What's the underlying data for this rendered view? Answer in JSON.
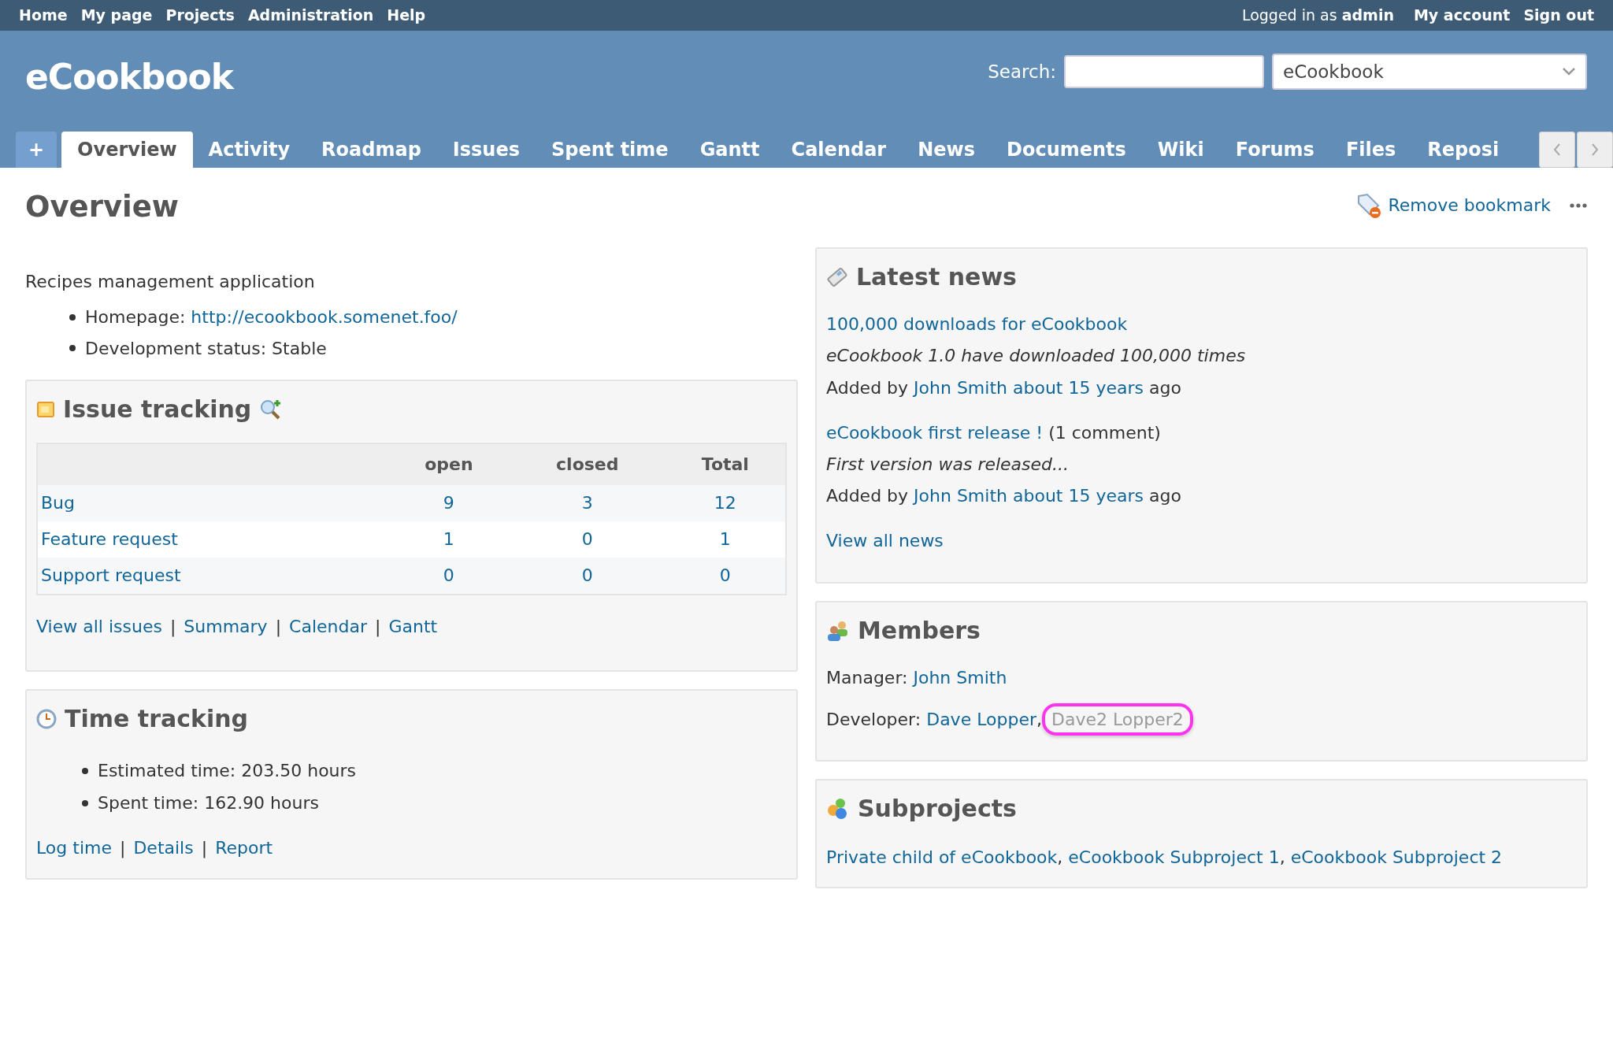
{
  "top_menu": [
    {
      "label": "Home"
    },
    {
      "label": "My page"
    },
    {
      "label": "Projects"
    },
    {
      "label": "Administration"
    },
    {
      "label": "Help"
    }
  ],
  "account": {
    "prefix": "Logged in as",
    "user": "admin",
    "links": [
      "My account",
      "Sign out"
    ]
  },
  "header": {
    "title": "eCookbook",
    "search_label": "Search:",
    "project_select": "eCookbook"
  },
  "tabs": [
    {
      "label": "+",
      "kind": "new",
      "selected": false
    },
    {
      "label": "Overview",
      "kind": "tab",
      "selected": true
    },
    {
      "label": "Activity",
      "kind": "tab",
      "selected": false
    },
    {
      "label": "Roadmap",
      "kind": "tab",
      "selected": false
    },
    {
      "label": "Issues",
      "kind": "tab",
      "selected": false
    },
    {
      "label": "Spent time",
      "kind": "tab",
      "selected": false
    },
    {
      "label": "Gantt",
      "kind": "tab",
      "selected": false
    },
    {
      "label": "Calendar",
      "kind": "tab",
      "selected": false
    },
    {
      "label": "News",
      "kind": "tab",
      "selected": false
    },
    {
      "label": "Documents",
      "kind": "tab",
      "selected": false
    },
    {
      "label": "Wiki",
      "kind": "tab",
      "selected": false
    },
    {
      "label": "Forums",
      "kind": "tab",
      "selected": false
    },
    {
      "label": "Files",
      "kind": "tab",
      "selected": false
    },
    {
      "label": "Reposi",
      "kind": "tab",
      "selected": false
    }
  ],
  "page": {
    "title": "Overview",
    "bookmark": "Remove bookmark"
  },
  "description": "Recipes management application",
  "attributes": [
    {
      "label": "Homepage:",
      "value": "http://ecookbook.somenet.foo/",
      "kind": "link"
    },
    {
      "label": "Development status:",
      "value": "Stable",
      "kind": "text"
    }
  ],
  "issue_tracking": {
    "title": "Issue tracking",
    "columns": [
      "open",
      "closed",
      "Total"
    ],
    "rows": [
      {
        "tracker": "Bug",
        "values": [
          "9",
          "3",
          "12"
        ]
      },
      {
        "tracker": "Feature request",
        "values": [
          "1",
          "0",
          "1"
        ]
      },
      {
        "tracker": "Support request",
        "values": [
          "0",
          "0",
          "0"
        ]
      }
    ],
    "links": [
      "View all issues",
      "Summary",
      "Calendar",
      "Gantt"
    ],
    "separator": "|"
  },
  "time_tracking": {
    "title": "Time tracking",
    "items": [
      "Estimated time: 203.50 hours",
      "Spent time: 162.90 hours"
    ],
    "links": [
      "Log time",
      "Details",
      "Report"
    ],
    "separator": "|"
  },
  "latest_news": {
    "title": "Latest news",
    "items": [
      {
        "title": "100,000 downloads for eCookbook",
        "summary": "eCookbook 1.0 have downloaded 100,000 times",
        "added_by": "Added by",
        "author": "John Smith",
        "age": "about 15 years",
        "suffix": "ago"
      },
      {
        "title": "eCookbook first release !",
        "comments": "(1 comment)",
        "summary": "First version was released...",
        "added_by": "Added by",
        "author": "John Smith",
        "age": "about 15 years",
        "suffix": "ago"
      }
    ],
    "view_all": "View all news"
  },
  "members": {
    "title": "Members",
    "separator": ",",
    "roles": [
      {
        "role": "Manager:",
        "people": [
          {
            "name": "John Smith",
            "locked": false,
            "highlighted": false
          }
        ]
      },
      {
        "role": "Developer:",
        "people": [
          {
            "name": "Dave Lopper",
            "locked": false,
            "highlighted": false
          },
          {
            "name": "Dave2 Lopper2",
            "locked": true,
            "highlighted": true
          }
        ]
      }
    ]
  },
  "subprojects": {
    "title": "Subprojects",
    "separator": ",",
    "items": [
      "Private child of eCookbook",
      "eCookbook Subproject 1",
      "eCookbook Subproject 2"
    ]
  }
}
